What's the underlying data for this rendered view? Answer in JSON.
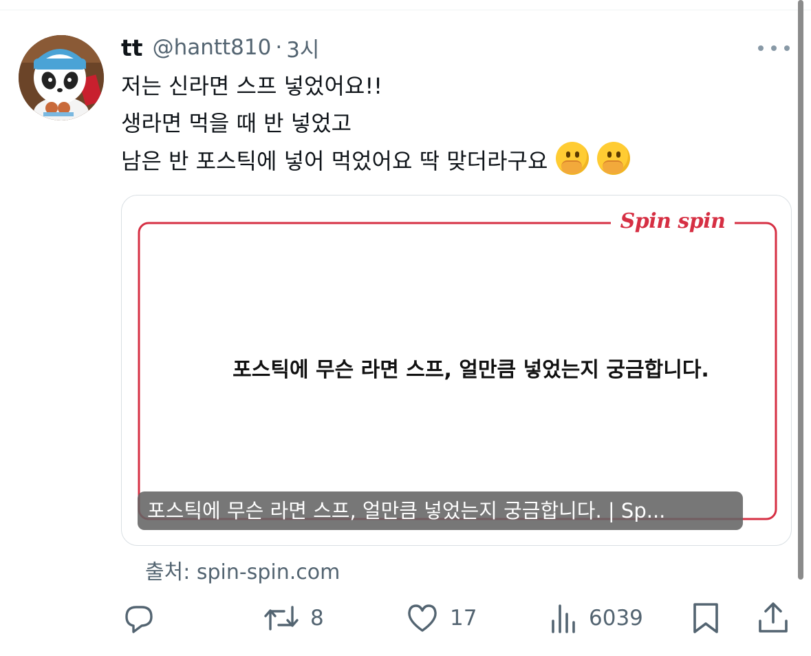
{
  "tweet": {
    "display_name": "tt",
    "handle": "@hantt810",
    "separator": "·",
    "time": "3시",
    "lines": [
      "저는 신라면 스프 넣었어요!!",
      "생라면 먹을 때 반 넣었고",
      "남은 반 포스틱에 넣어 먹었어요 딱 맞더라구요"
    ],
    "emojis": [
      "face-with-hand-over-mouth-icon",
      "face-with-hand-over-mouth-icon"
    ]
  },
  "card": {
    "logo_text": "Spin spin",
    "headline": "포스틱에 무슨 라면 스프, 얼만큼 넣었는지 궁금합니다.",
    "caption": "포스틱에 무슨 라면 스프, 얼만큼 넣었는지 궁금합니다. | Sp...",
    "frame_color": "#d62f43"
  },
  "source": "출처: spin-spin.com",
  "actions": {
    "reply": {
      "icon": "reply-icon",
      "count": ""
    },
    "retweet": {
      "icon": "retweet-icon",
      "count": "8"
    },
    "like": {
      "icon": "heart-icon",
      "count": "17"
    },
    "views": {
      "icon": "views-icon",
      "count": "6039"
    },
    "bookmark": {
      "icon": "bookmark-icon"
    },
    "share": {
      "icon": "share-icon"
    }
  },
  "colors": {
    "text": "#0f1419",
    "secondary": "#536471",
    "accent_red": "#d62f43"
  }
}
